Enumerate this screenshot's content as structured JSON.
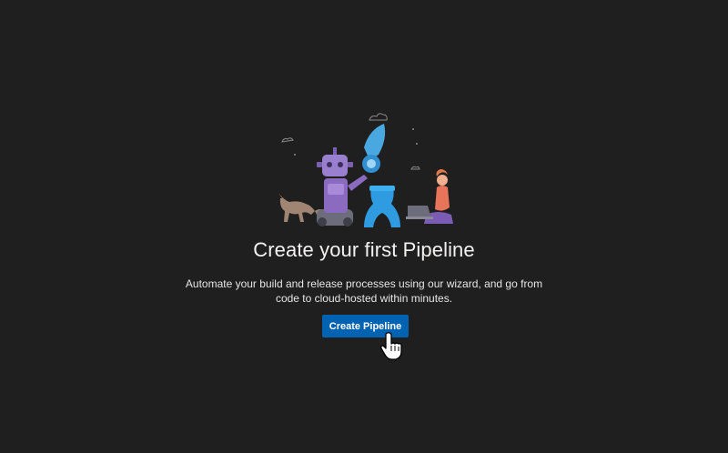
{
  "empty_state": {
    "illustration_icon": "pipeline-robot-rocket-illustration",
    "title": "Create your first Pipeline",
    "description": "Automate your build and release processes using our wizard, and go from code to cloud-hosted within minutes.",
    "button_label": "Create Pipeline"
  },
  "cursor_icon": "hand-pointer-icon",
  "colors": {
    "background": "#201f1f",
    "primary_button": "#0063b1",
    "title_text": "#f3f2f1"
  }
}
